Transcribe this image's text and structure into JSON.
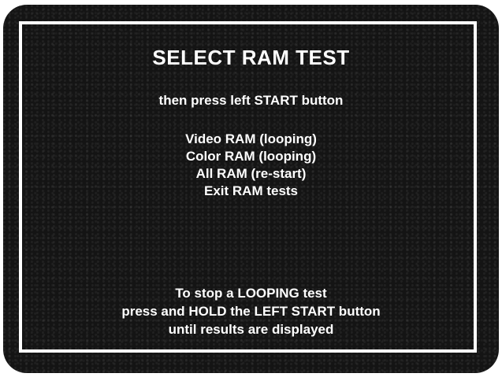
{
  "screen": {
    "title": "SELECT RAM TEST",
    "instruction": "then press left START button",
    "menu": {
      "items": [
        "Video RAM (looping)",
        "Color RAM (looping)",
        "All RAM (re-start)",
        "Exit RAM tests"
      ]
    },
    "note": {
      "lines": [
        "To stop a LOOPING test",
        "press and HOLD the LEFT START button",
        "until results are displayed"
      ]
    }
  }
}
